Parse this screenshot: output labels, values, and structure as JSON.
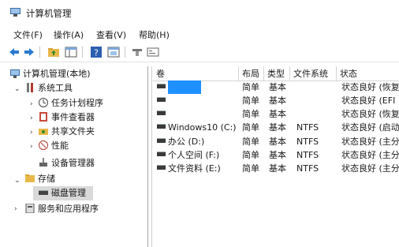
{
  "window": {
    "title": "计算机管理"
  },
  "menu": [
    "文件(F)",
    "操作(A)",
    "查看(V)",
    "帮助(H)"
  ],
  "toolbar": {
    "icons": [
      "back-icon",
      "forward-icon",
      "up-folder-icon",
      "show-tree-icon",
      "help-icon",
      "properties-icon",
      "connect-icon",
      "console-icon"
    ]
  },
  "tree": {
    "root": "计算机管理(本地)",
    "system_tools": "系统工具",
    "task_scheduler": "任务计划程序",
    "event_viewer": "事件查看器",
    "shared_folders": "共享文件夹",
    "performance": "性能",
    "device_manager": "设备管理器",
    "storage": "存储",
    "disk_management": "磁盘管理",
    "services_apps": "服务和应用程序"
  },
  "table": {
    "headers": [
      "卷",
      "布局",
      "类型",
      "文件系统",
      "状态"
    ],
    "rows": [
      {
        "volume": "",
        "layout": "简单",
        "type": "基本",
        "fs": "",
        "status": "状态良好 (恢复"
      },
      {
        "volume": "",
        "layout": "简单",
        "type": "基本",
        "fs": "",
        "status": "状态良好 (EFI"
      },
      {
        "volume": "",
        "layout": "简单",
        "type": "基本",
        "fs": "",
        "status": "状态良好 (恢复"
      },
      {
        "volume": "Windows10 (C:)",
        "layout": "简单",
        "type": "基本",
        "fs": "NTFS",
        "status": "状态良好 (启动"
      },
      {
        "volume": "办公 (D:)",
        "layout": "简单",
        "type": "基本",
        "fs": "NTFS",
        "status": "状态良好 (主分"
      },
      {
        "volume": "个人空间 (F:)",
        "layout": "简单",
        "type": "基本",
        "fs": "NTFS",
        "status": "状态良好 (主分"
      },
      {
        "volume": "文件资料 (E:)",
        "layout": "简单",
        "type": "基本",
        "fs": "NTFS",
        "status": "状态良好 (主分"
      }
    ]
  },
  "colors": {
    "selection": "#d9d9d9",
    "highlight": "#1e90ff",
    "accent": "#2b6cc4"
  }
}
